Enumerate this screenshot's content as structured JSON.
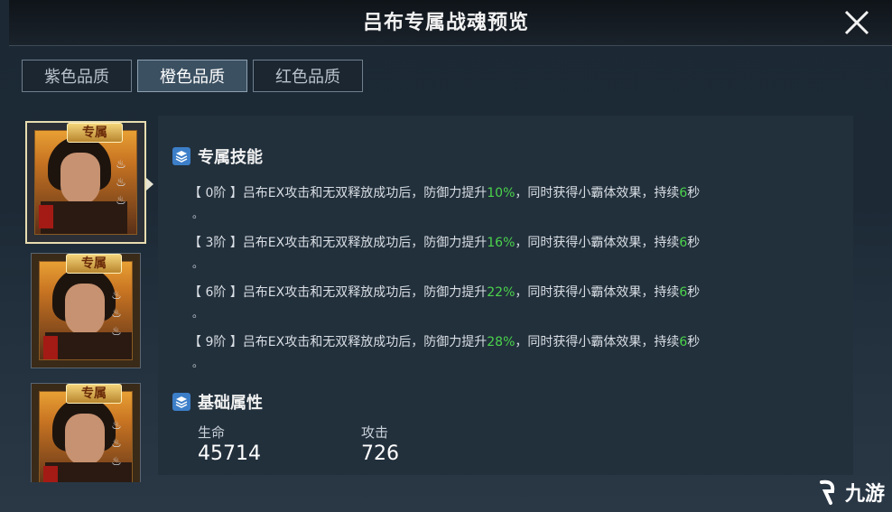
{
  "window": {
    "title": "吕布专属战魂预览"
  },
  "tabs": [
    {
      "label": "紫色品质",
      "active": false
    },
    {
      "label": "橙色品质",
      "active": true
    },
    {
      "label": "红色品质",
      "active": false
    }
  ],
  "cards": [
    {
      "badge": "专属",
      "corner": "灭",
      "selected": true
    },
    {
      "badge": "专属",
      "corner": "灭",
      "selected": false
    },
    {
      "badge": "专属",
      "corner": "灭",
      "selected": false
    }
  ],
  "sections": {
    "skill_title": "专属技能",
    "attr_title": "基础属性"
  },
  "skills": [
    {
      "level": "【 0阶 】",
      "text_a": "吕布EX攻击和无双释放成功后，防御力提升",
      "pct": "10%",
      "text_b": "，同时获得小霸体效果，持续",
      "dur": "6",
      "unit": "秒"
    },
    {
      "level": "【 3阶 】",
      "text_a": "吕布EX攻击和无双释放成功后，防御力提升",
      "pct": "16%",
      "text_b": "，同时获得小霸体效果，持续",
      "dur": "6",
      "unit": "秒"
    },
    {
      "level": "【 6阶 】",
      "text_a": "吕布EX攻击和无双释放成功后，防御力提升",
      "pct": "22%",
      "text_b": "，同时获得小霸体效果，持续",
      "dur": "6",
      "unit": "秒"
    },
    {
      "level": "【 9阶 】",
      "text_a": "吕布EX攻击和无双释放成功后，防御力提升",
      "pct": "28%",
      "text_b": "，同时获得小霸体效果，持续",
      "dur": "6",
      "unit": "秒"
    }
  ],
  "skill_tail": "。",
  "attrs": {
    "hp_label": "生命",
    "hp_value": "45714",
    "atk_label": "攻击",
    "atk_value": "726"
  },
  "watermark": {
    "text": "九游"
  },
  "colors": {
    "highlight": "#4bd34b",
    "tab_active": "#3b5061",
    "icon_blue": "#3c7ec8"
  }
}
